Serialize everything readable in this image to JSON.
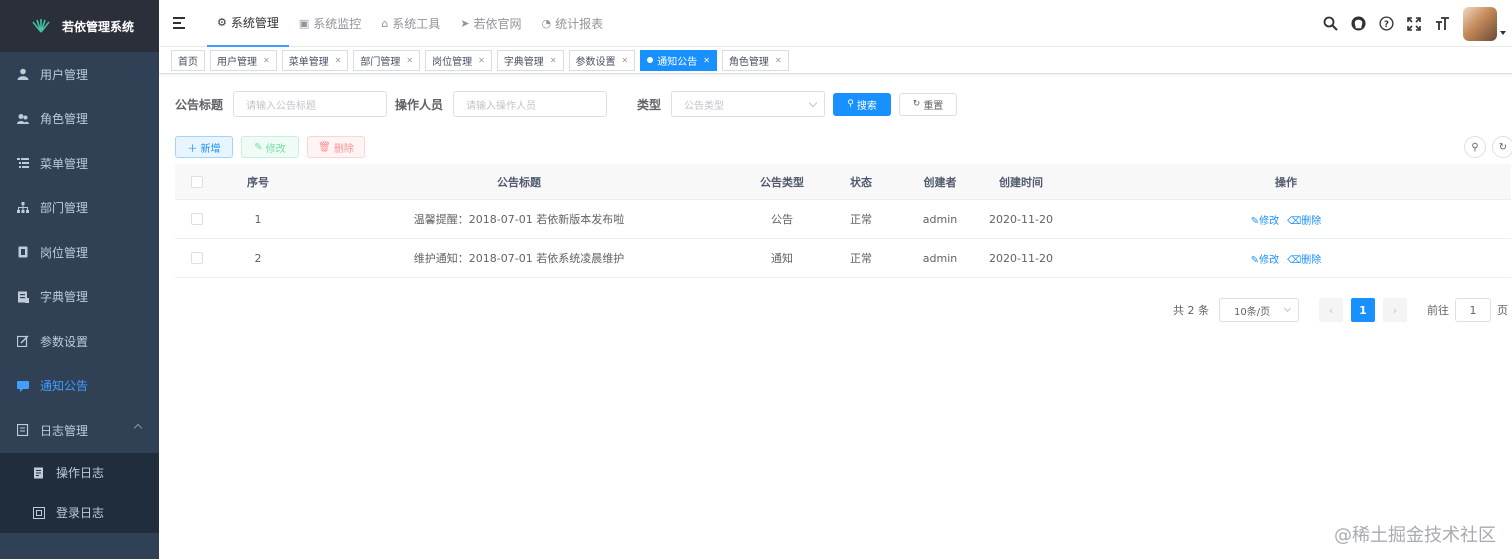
{
  "sidebar": {
    "logo_title": "若依管理系统",
    "items": [
      {
        "label": "用户管理",
        "icon": "user-icon"
      },
      {
        "label": "角色管理",
        "icon": "peoples-icon"
      },
      {
        "label": "菜单管理",
        "icon": "tree-table-icon"
      },
      {
        "label": "部门管理",
        "icon": "tree-icon"
      },
      {
        "label": "岗位管理",
        "icon": "post-icon"
      },
      {
        "label": "字典管理",
        "icon": "dict-icon"
      },
      {
        "label": "参数设置",
        "icon": "edit-icon"
      },
      {
        "label": "通知公告",
        "icon": "message-icon",
        "active": true
      },
      {
        "label": "日志管理",
        "icon": "log-icon",
        "expanded": true
      }
    ],
    "sub_items": [
      {
        "label": "操作日志",
        "icon": "form-icon"
      },
      {
        "label": "登录日志",
        "icon": "logininfor-icon"
      }
    ]
  },
  "navbar": {
    "menus": [
      {
        "label": "系统管理",
        "icon": "system-icon",
        "active": true
      },
      {
        "label": "系统监控",
        "icon": "monitor-icon"
      },
      {
        "label": "系统工具",
        "icon": "tool-icon"
      },
      {
        "label": "若依官网",
        "icon": "guide-icon"
      },
      {
        "label": "统计报表",
        "icon": "dashboard-icon"
      }
    ]
  },
  "tags": [
    {
      "label": "首页",
      "closable": false
    },
    {
      "label": "用户管理",
      "closable": true
    },
    {
      "label": "菜单管理",
      "closable": true
    },
    {
      "label": "部门管理",
      "closable": true
    },
    {
      "label": "岗位管理",
      "closable": true
    },
    {
      "label": "字典管理",
      "closable": true
    },
    {
      "label": "参数设置",
      "closable": true
    },
    {
      "label": "通知公告",
      "closable": true,
      "active": true
    },
    {
      "label": "角色管理",
      "closable": true
    }
  ],
  "search": {
    "title_label": "公告标题",
    "title_placeholder": "请输入公告标题",
    "operator_label": "操作人员",
    "operator_placeholder": "请输入操作人员",
    "type_label": "类型",
    "type_placeholder": "公告类型",
    "search_btn": "搜索",
    "reset_btn": "重置"
  },
  "toolbar": {
    "add": "新增",
    "edit": "修改",
    "delete": "删除"
  },
  "table": {
    "headers": [
      "序号",
      "公告标题",
      "公告类型",
      "状态",
      "创建者",
      "创建时间",
      "操作"
    ],
    "rows": [
      {
        "idx": "1",
        "title": "温馨提醒：2018-07-01 若依新版本发布啦",
        "type": "公告",
        "status": "正常",
        "creator": "admin",
        "time": "2020-11-20",
        "edit": "修改",
        "delete": "删除"
      },
      {
        "idx": "2",
        "title": "维护通知：2018-07-01 若依系统凌晨维护",
        "type": "通知",
        "status": "正常",
        "creator": "admin",
        "time": "2020-11-20",
        "edit": "修改",
        "delete": "删除"
      }
    ]
  },
  "pagination": {
    "total": "共 2 条",
    "page_size": "10条/页",
    "current": "1",
    "goto_prefix": "前往",
    "goto_value": "1",
    "goto_suffix": "页"
  },
  "watermark": "@稀土掘金技术社区",
  "colors": {
    "sidebar_bg": "#304156",
    "accent": "#1890ff",
    "active_menu": "#409eff"
  }
}
